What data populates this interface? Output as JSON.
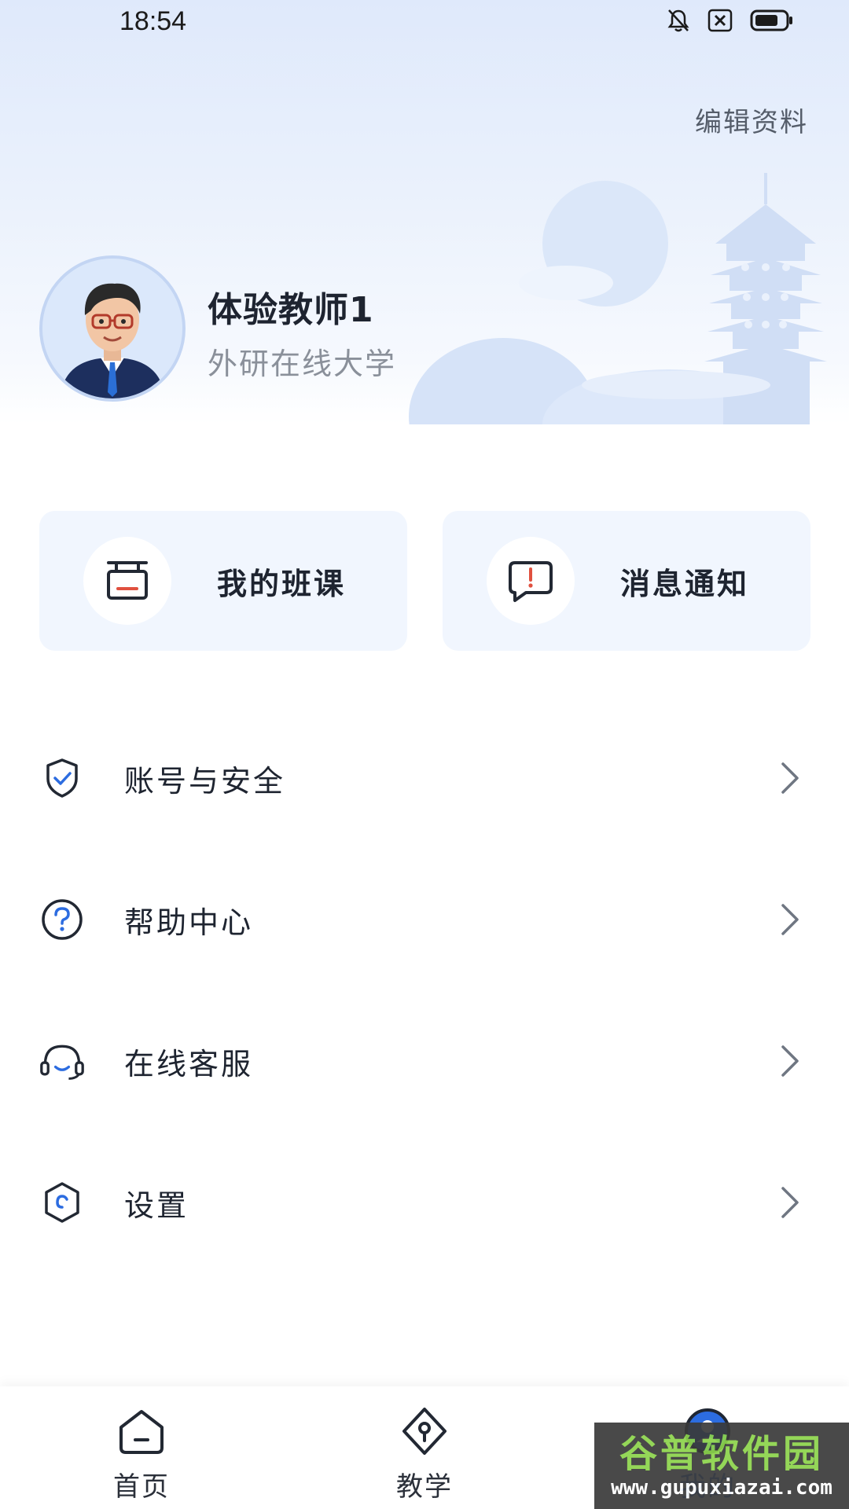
{
  "status_bar": {
    "time": "18:54",
    "icons": [
      "bell-off-icon",
      "close-box-icon",
      "battery-icon"
    ]
  },
  "header": {
    "edit_profile_label": "编辑资料"
  },
  "profile": {
    "name": "体验教师1",
    "organization": "外研在线大学"
  },
  "quick_cards": [
    {
      "label": "我的班课",
      "icon": "classroom-icon"
    },
    {
      "label": "消息通知",
      "icon": "message-alert-icon"
    }
  ],
  "menu": [
    {
      "label": "账号与安全",
      "icon": "shield-check-icon"
    },
    {
      "label": "帮助中心",
      "icon": "help-circle-icon"
    },
    {
      "label": "在线客服",
      "icon": "headset-icon"
    },
    {
      "label": "设置",
      "icon": "settings-hexagon-icon"
    }
  ],
  "bottom_nav": [
    {
      "label": "首页",
      "icon": "home-icon",
      "active": false
    },
    {
      "label": "教学",
      "icon": "teaching-icon",
      "active": false
    },
    {
      "label": "我的",
      "icon": "profile-icon",
      "active": true
    }
  ],
  "watermark": {
    "title": "谷普软件园",
    "url": "www.gupuxiazai.com"
  },
  "colors": {
    "accent": "#2c6ce0",
    "card_bg": "#f1f6fe",
    "header_bg": "#e4edfb"
  }
}
